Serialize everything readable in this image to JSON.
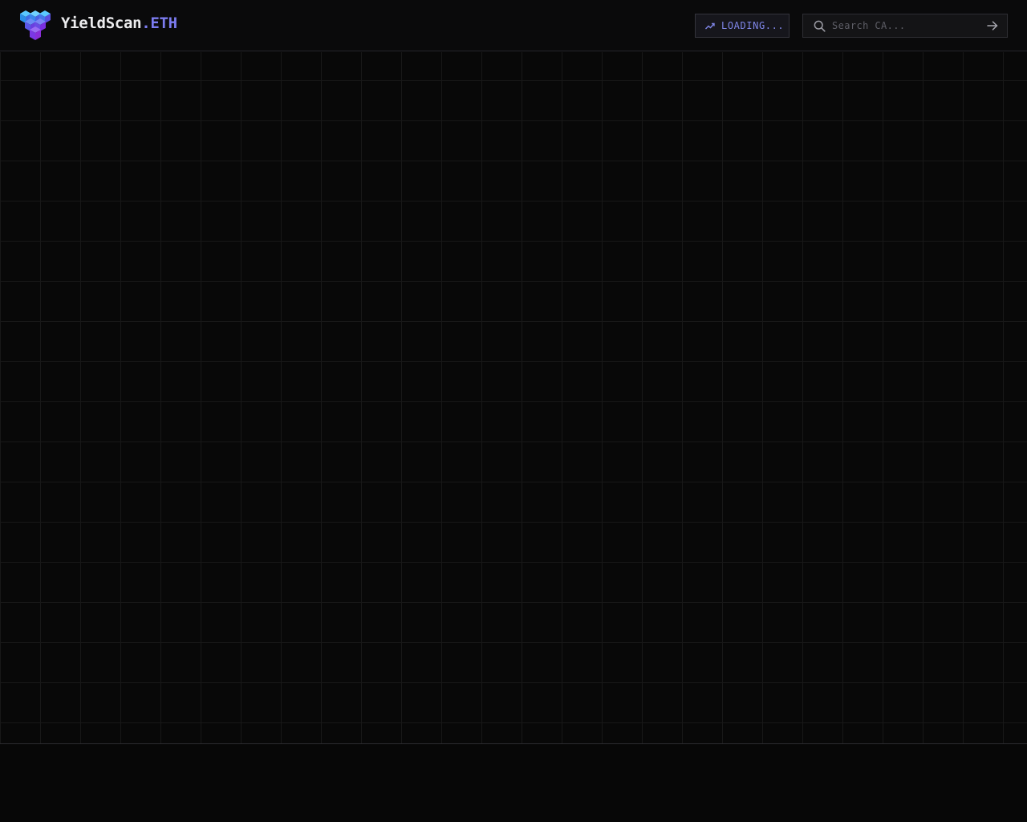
{
  "brand": {
    "name": "YieldScan",
    "tld": ".ETH"
  },
  "status": {
    "label": "LOADING...",
    "icon": "trending-up-icon"
  },
  "search": {
    "placeholder": "Search CA...",
    "value": "",
    "icon": "search-icon",
    "submit_icon": "arrow-right-icon"
  },
  "colors": {
    "background": "#080808",
    "accent": "#7c7cf0",
    "logo_top": "#2fa4f0",
    "logo_bottom": "#7a2ee0"
  }
}
